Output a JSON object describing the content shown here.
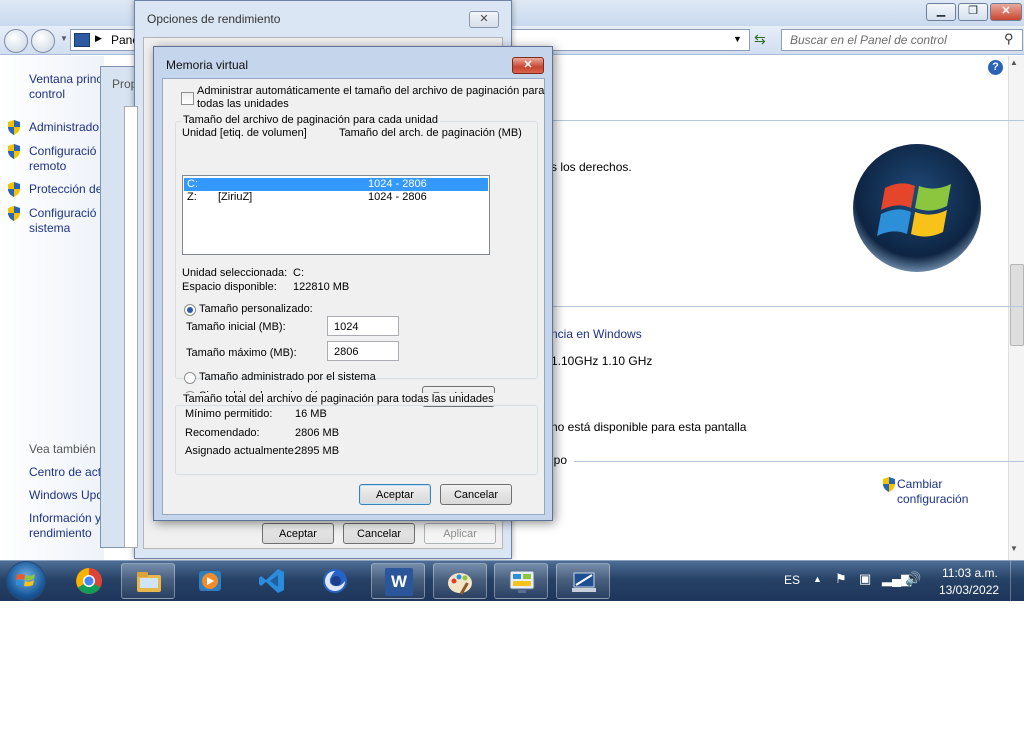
{
  "control_panel": {
    "breadcrumb_root": "Pane",
    "search_placeholder": "Buscar en el Panel de control",
    "left_links": [
      {
        "label": "Ventana princ",
        "label2": "control"
      },
      {
        "label": "Administrado"
      },
      {
        "label": "Configuració",
        "label2": "remoto"
      },
      {
        "label": "Protección de"
      },
      {
        "label": "Configuració",
        "label2": "sistema"
      }
    ],
    "see_also_heading": "Vea también",
    "see_also_links": [
      "Centro de act",
      "Windows Upd",
      "Información y",
      "rendimiento"
    ],
    "content_text": {
      "rights": "s los derechos.",
      "rating_link": "ncia en Windows",
      "cpu": "1.10GHz  1.10 GHz",
      "pen": "no está disponible para esta pantalla",
      "group_label": "ipo",
      "change_settings_1": "Cambiar",
      "change_settings_2": "configuración"
    },
    "props_tab": "Prop"
  },
  "performance_options": {
    "title": "Opciones de rendimiento",
    "close_glyph": "✕",
    "ok": "Aceptar",
    "cancel": "Cancelar",
    "apply": "Aplicar"
  },
  "virtual_memory": {
    "title": "Memoria virtual",
    "close_glyph": "✕",
    "auto_manage": "Administrar automáticamente el tamaño del archivo de paginación para",
    "auto_manage_2": "todas las unidades",
    "auto_manage_checked": false,
    "group_title": "Tamaño del archivo de paginación para cada unidad",
    "col_drive": "Unidad [etiq. de volumen]",
    "col_size": "Tamaño del arch. de paginación (MB)",
    "drives": [
      {
        "drive": "C:",
        "label": "",
        "size": "1024 - 2806",
        "selected": true
      },
      {
        "drive": "Z:",
        "label": "[ZiriuZ]",
        "size": "1024 - 2806",
        "selected": false
      }
    ],
    "selected_drive_label": "Unidad seleccionada:",
    "selected_drive_value": "C:",
    "free_space_label": "Espacio disponible:",
    "free_space_value": "122810 MB",
    "custom_size": "Tamaño personalizado:",
    "initial_size_label": "Tamaño inicial (MB):",
    "initial_size_value": "1024",
    "max_size_label": "Tamaño máximo (MB):",
    "max_size_value": "2806",
    "system_managed": "Tamaño administrado por el sistema",
    "no_paging": "Sin archivo de paginación",
    "set_button": "Establecer",
    "total_group_title": "Tamaño total del archivo de paginación para todas las unidades",
    "min_label": "Mínimo permitido:",
    "min_value": "16 MB",
    "recommended_label": "Recomendado:",
    "recommended_value": "2806 MB",
    "allocated_label": "Asignado actualmente:",
    "allocated_value": "2895 MB",
    "ok": "Aceptar",
    "cancel": "Cancelar"
  },
  "taskbar": {
    "language": "ES",
    "time": "11:03 a.m.",
    "date": "13/03/2022",
    "word_letter": "W",
    "apps": [
      "start-icon",
      "chrome-icon",
      "file-explorer-icon",
      "media-player-icon",
      "vscode-icon",
      "firefox-icon",
      "word-icon",
      "paint-icon",
      "control-panel-icon",
      "system-icon"
    ]
  },
  "colors": {
    "accent": "#3399ff",
    "link": "#1e3287",
    "taskbar": "#274266"
  }
}
